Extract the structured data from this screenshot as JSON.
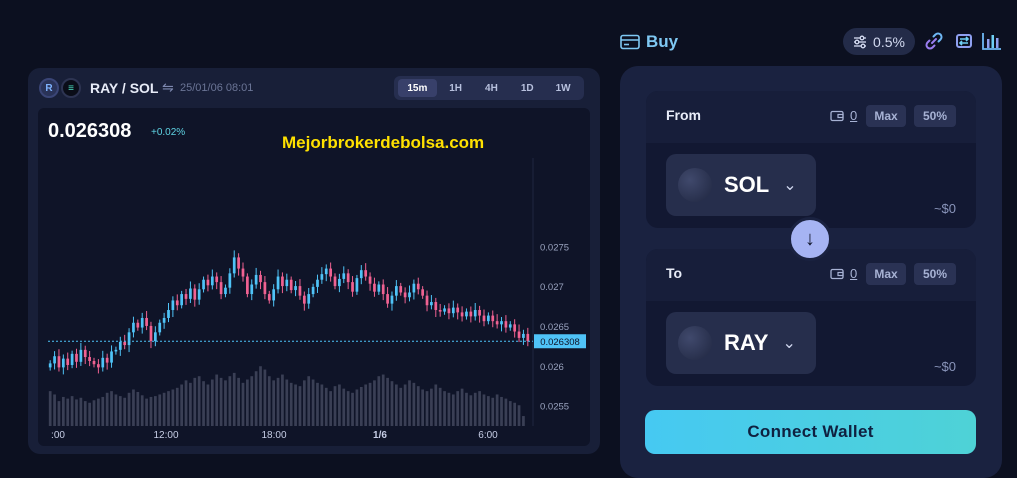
{
  "chart_header": {
    "token_a_icon": "ray-token-icon",
    "token_b_icon": "sol-token-icon",
    "pair": "RAY / SOL",
    "swap_icon": "⇋",
    "datetime": "25/01/06 08:01",
    "timeframes": [
      "15m",
      "1H",
      "4H",
      "1D",
      "1W"
    ],
    "active_timeframe": "15m"
  },
  "price": {
    "current": "0.026308",
    "change": "+0.02%"
  },
  "watermark": "Mejorbrokerdebolsa.com",
  "chart_data": {
    "type": "candlestick",
    "y_ticks": [
      "0.0275",
      "0.027",
      "0.0265",
      "0.026",
      "0.0255"
    ],
    "y_tick_values": [
      0.0275,
      0.027,
      0.0265,
      0.026,
      0.0255
    ],
    "ylim": [
      0.02537,
      0.02798
    ],
    "x_ticks": [
      ":00",
      "12:00",
      "18:00",
      "1/6",
      "6:00"
    ],
    "current_price_label": "0.026308",
    "current_price": 0.026308,
    "up_color": "#4fc3f7",
    "down_color": "#f06292",
    "volume_color": "#3a3f55",
    "close": [
      0.02603,
      0.02612,
      0.02598,
      0.02609,
      0.02601,
      0.02615,
      0.02605,
      0.0262,
      0.02611,
      0.02606,
      0.02602,
      0.02598,
      0.0261,
      0.02604,
      0.02618,
      0.0262,
      0.0263,
      0.02626,
      0.02642,
      0.02654,
      0.02648,
      0.0266,
      0.0265,
      0.02631,
      0.02642,
      0.02654,
      0.0266,
      0.0267,
      0.02682,
      0.02676,
      0.0269,
      0.02684,
      0.02697,
      0.02683,
      0.02696,
      0.02708,
      0.02701,
      0.02712,
      0.02705,
      0.0269,
      0.02698,
      0.02716,
      0.02736,
      0.02722,
      0.02712,
      0.0269,
      0.02702,
      0.02714,
      0.02705,
      0.0269,
      0.02682,
      0.02696,
      0.02712,
      0.027,
      0.02708,
      0.02695,
      0.027,
      0.02688,
      0.02678,
      0.0269,
      0.02699,
      0.02708,
      0.02715,
      0.02722,
      0.02712,
      0.027,
      0.02709,
      0.02716,
      0.02705,
      0.02693,
      0.0271,
      0.0272,
      0.02712,
      0.02703,
      0.02693,
      0.02702,
      0.0269,
      0.02678,
      0.02688,
      0.027,
      0.02692,
      0.02686,
      0.02692,
      0.02703,
      0.02696,
      0.02688,
      0.02676,
      0.0268,
      0.0267,
      0.02668,
      0.02672,
      0.02666,
      0.02673,
      0.02667,
      0.02662,
      0.02668,
      0.02662,
      0.0267,
      0.02663,
      0.02656,
      0.02663,
      0.02656,
      0.02652,
      0.02656,
      0.02648,
      0.02652,
      0.02643,
      0.02635,
      0.0264,
      0.02631
    ],
    "volume": [
      0.42,
      0.38,
      0.3,
      0.35,
      0.33,
      0.36,
      0.32,
      0.34,
      0.3,
      0.28,
      0.31,
      0.33,
      0.35,
      0.4,
      0.42,
      0.38,
      0.36,
      0.34,
      0.4,
      0.44,
      0.41,
      0.37,
      0.33,
      0.35,
      0.36,
      0.38,
      0.4,
      0.42,
      0.44,
      0.46,
      0.5,
      0.55,
      0.52,
      0.58,
      0.6,
      0.54,
      0.5,
      0.56,
      0.62,
      0.58,
      0.55,
      0.6,
      0.64,
      0.58,
      0.52,
      0.56,
      0.6,
      0.66,
      0.72,
      0.68,
      0.6,
      0.55,
      0.58,
      0.62,
      0.56,
      0.52,
      0.5,
      0.48,
      0.55,
      0.6,
      0.56,
      0.52,
      0.5,
      0.46,
      0.42,
      0.48,
      0.5,
      0.45,
      0.42,
      0.4,
      0.44,
      0.47,
      0.5,
      0.52,
      0.55,
      0.6,
      0.62,
      0.58,
      0.54,
      0.5,
      0.46,
      0.5,
      0.55,
      0.52,
      0.48,
      0.44,
      0.42,
      0.45,
      0.5,
      0.46,
      0.42,
      0.4,
      0.38,
      0.42,
      0.45,
      0.4,
      0.37,
      0.4,
      0.42,
      0.38,
      0.36,
      0.34,
      0.38,
      0.35,
      0.33,
      0.3,
      0.28,
      0.25,
      0.12
    ]
  },
  "buy": {
    "label": "Buy",
    "icon": "card-icon"
  },
  "slippage": {
    "value": "0.5%",
    "icon": "sliders-icon"
  },
  "top_icons": [
    "link-icon",
    "swap-route-icon",
    "bar-chart-icon"
  ],
  "from": {
    "title": "From",
    "balance": "0",
    "max_label": "Max",
    "half_label": "50%",
    "token": "SOL",
    "usd_value": "~$0"
  },
  "to": {
    "title": "To",
    "balance": "0",
    "max_label": "Max",
    "half_label": "50%",
    "token": "RAY",
    "usd_value": "~$0"
  },
  "swap_direction_icon": "↓",
  "connect_button": "Connect Wallet",
  "colors": {
    "background": "#0c1020",
    "panel": "#1a2240",
    "accent": "#46c9f2",
    "watermark": "#ffe100"
  }
}
